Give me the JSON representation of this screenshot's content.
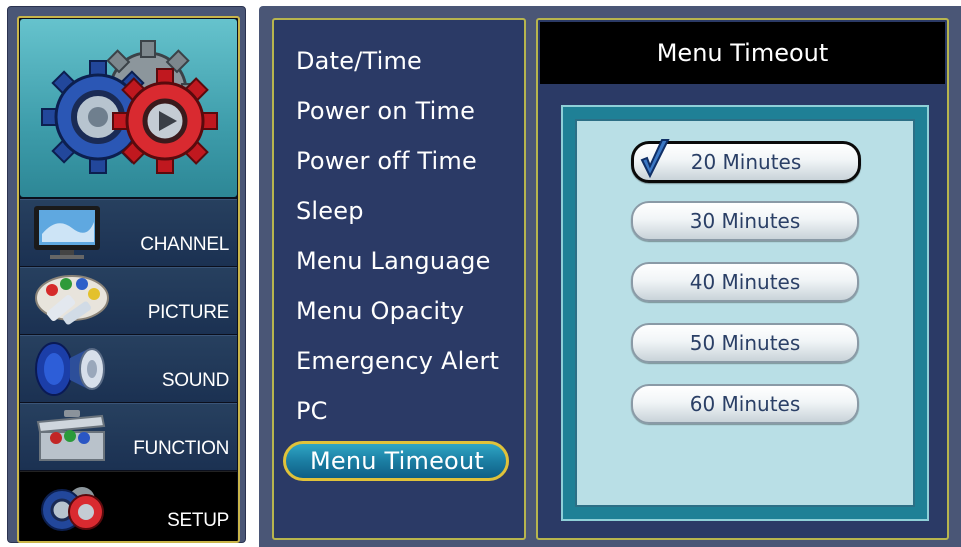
{
  "sidebar": {
    "items": [
      {
        "label": "CHANNEL",
        "icon": "tv-icon"
      },
      {
        "label": "PICTURE",
        "icon": "palette-icon"
      },
      {
        "label": "SOUND",
        "icon": "speaker-icon"
      },
      {
        "label": "FUNCTION",
        "icon": "toolbox-icon"
      },
      {
        "label": "SETUP",
        "icon": "gears-icon",
        "active": true
      }
    ],
    "header_icon": "gears-icon"
  },
  "menu": {
    "items": [
      {
        "label": "Date/Time"
      },
      {
        "label": "Power on Time"
      },
      {
        "label": "Power off Time"
      },
      {
        "label": "Sleep"
      },
      {
        "label": "Menu Language"
      },
      {
        "label": "Menu Opacity"
      },
      {
        "label": "Emergency Alert"
      },
      {
        "label": "PC"
      },
      {
        "label": "Menu Timeout",
        "selected": true
      }
    ]
  },
  "options": {
    "title": "Menu Timeout",
    "items": [
      {
        "label": "20 Minutes",
        "checked": true
      },
      {
        "label": "30 Minutes"
      },
      {
        "label": "40 Minutes"
      },
      {
        "label": "50 Minutes"
      },
      {
        "label": "60 Minutes"
      }
    ]
  },
  "colors": {
    "panel": "#4a5676",
    "menu_bg": "#2b3a66",
    "border_gold": "#b7b54e",
    "selected_fill": "#1b7ea3",
    "option_text": "#2a3f66"
  }
}
